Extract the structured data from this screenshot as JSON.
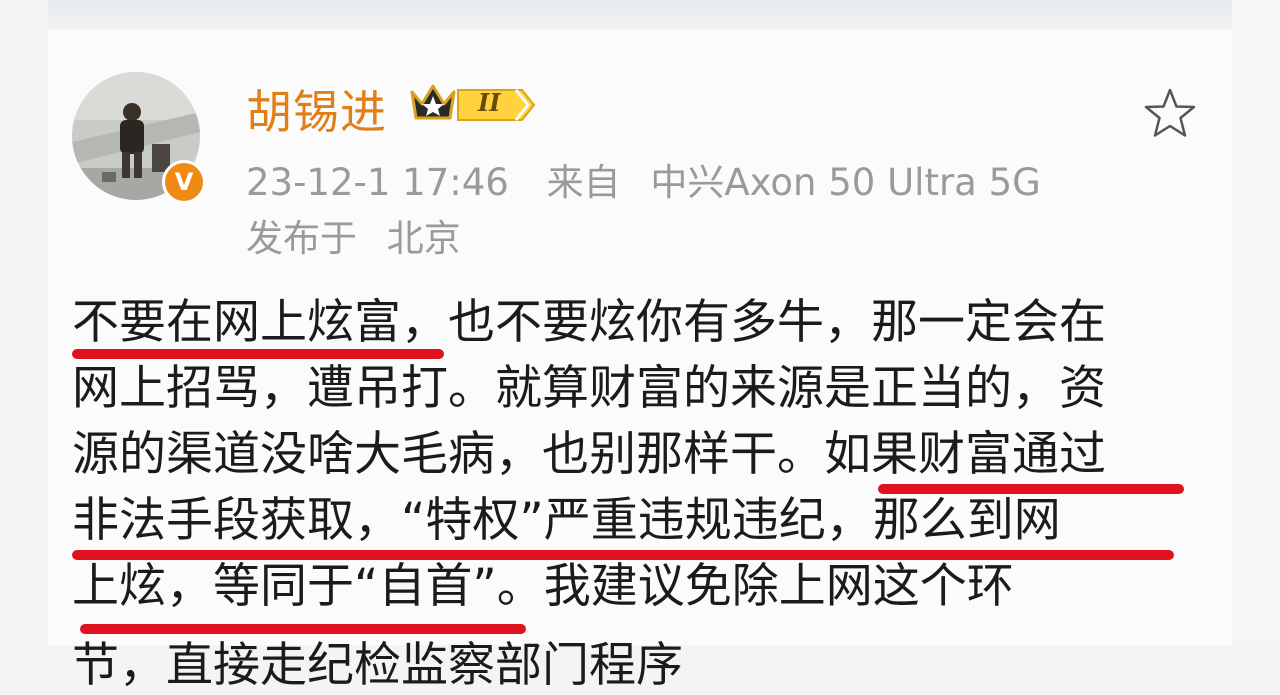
{
  "post": {
    "author": {
      "name": "胡锡进",
      "level": "II",
      "verified_icon": "v-verified-icon",
      "crown_icon": "crown-icon"
    },
    "timestamp": "23-12-1 17:46",
    "source_label": "来自",
    "source_device": "中兴Axon 50 Ultra 5G",
    "location_label": "发布于",
    "location": "北京",
    "favorite_icon": "star-outline-icon",
    "body_lines": [
      "不要在网上炫富，也不要炫你有多牛，那一定会在",
      "网上招骂，遭吊打。就算财富的来源是正当的，资",
      "源的渠道没啥大毛病，也别那样干。如果财富通过",
      "非法手段获取，“特权”严重违规违纪，那么到网",
      "上炫，等同于“自首”。我建议免除上网这个环"
    ],
    "cut_line": "节，直接走纪检监察部门程序"
  },
  "colors": {
    "username": "#e07f18",
    "meta_text": "#9a9a9a",
    "body_text": "#1b1b1b",
    "underline": "#e0121f",
    "verified_badge": "#f08a16"
  }
}
